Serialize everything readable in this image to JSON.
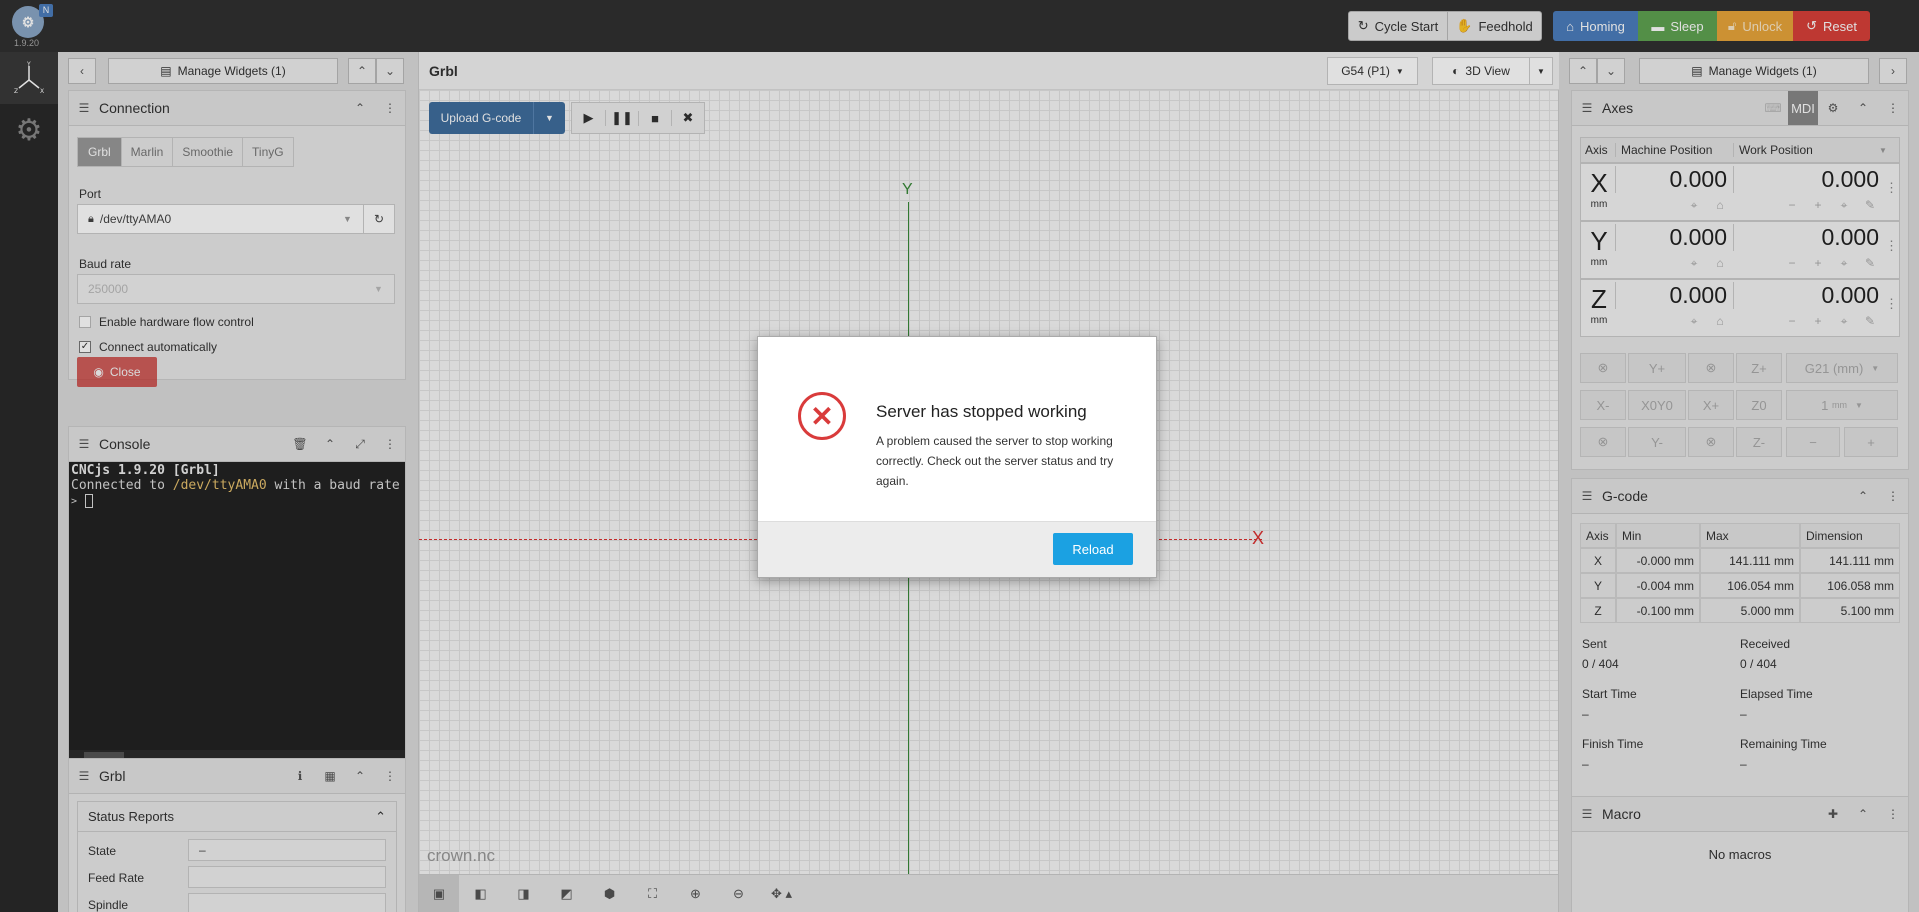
{
  "app": {
    "version": "1.9.20",
    "badge": "N"
  },
  "topbar": {
    "cycle_start": "Cycle Start",
    "feedhold": "Feedhold",
    "homing": "Homing",
    "sleep": "Sleep",
    "unlock": "Unlock",
    "reset": "Reset"
  },
  "colors": {
    "homing": "#4c7ebd",
    "sleep": "#5fa351",
    "unlock": "#e9a53b",
    "reset": "#d9403a",
    "reload": "#1ba1e2",
    "error": "#d93b3b"
  },
  "left": {
    "manage_widgets": "Manage Widgets (1)",
    "connection": {
      "title": "Connection",
      "tabs": [
        "Grbl",
        "Marlin",
        "Smoothie",
        "TinyG"
      ],
      "port_label": "Port",
      "port_value": "/dev/ttyAMA0",
      "baud_label": "Baud rate",
      "baud_value": "250000",
      "hw_flow": "Enable hardware flow control",
      "connect_auto": "Connect automatically",
      "close_button": "Close"
    },
    "console": {
      "title": "Console",
      "line1": "CNCjs 1.9.20 [Grbl]",
      "line2_prefix": "Connected to ",
      "line2_port": "/dev/ttyAMA0",
      "line2_suffix": " with a baud rate",
      "prompt": ">"
    },
    "grbl": {
      "title": "Grbl",
      "status_reports": "Status Reports",
      "state_label": "State",
      "state_value": "–",
      "feed_label": "Feed Rate",
      "spindle_label": "Spindle"
    }
  },
  "center": {
    "title": "Grbl",
    "coord_system": "G54 (P1)",
    "view": "3D View",
    "upload": "Upload G-code",
    "axis_y": "Y",
    "axis_x": "X",
    "filename": "crown.nc"
  },
  "right": {
    "manage_widgets": "Manage Widgets (1)",
    "axes": {
      "title": "Axes",
      "mdi": "MDI",
      "col_axis": "Axis",
      "col_machine": "Machine Position",
      "col_work": "Work Position",
      "rows": [
        {
          "axis": "X",
          "unit": "mm",
          "machine": "0.000",
          "work": "0.000"
        },
        {
          "axis": "Y",
          "unit": "mm",
          "machine": "0.000",
          "work": "0.000"
        },
        {
          "axis": "Z",
          "unit": "mm",
          "machine": "0.000",
          "work": "0.000"
        }
      ],
      "jog": {
        "yplus": "Y+",
        "zplus": "Z+",
        "units": "G21 (mm)",
        "xminus": "X-",
        "x0y0": "X0Y0",
        "xplus": "X+",
        "z0": "Z0",
        "step": "1",
        "step_unit": "mm",
        "yminus": "Y-",
        "zminus": "Z-",
        "minus": "−",
        "plus": "+"
      }
    },
    "gcode": {
      "title": "G-code",
      "headers": [
        "Axis",
        "Min",
        "Max",
        "Dimension"
      ],
      "rows": [
        [
          "X",
          "-0.000 mm",
          "141.111 mm",
          "141.111 mm"
        ],
        [
          "Y",
          "-0.004 mm",
          "106.054 mm",
          "106.058 mm"
        ],
        [
          "Z",
          "-0.100 mm",
          "5.000 mm",
          "5.100 mm"
        ]
      ],
      "sent_label": "Sent",
      "sent_value": "0 / 404",
      "received_label": "Received",
      "received_value": "0 / 404",
      "start_label": "Start Time",
      "start_value": "–",
      "elapsed_label": "Elapsed Time",
      "elapsed_value": "–",
      "finish_label": "Finish Time",
      "finish_value": "–",
      "remaining_label": "Remaining Time",
      "remaining_value": "–"
    },
    "macro": {
      "title": "Macro",
      "empty": "No macros"
    }
  },
  "modal": {
    "title": "Server has stopped working",
    "message": "A problem caused the server to stop working correctly. Check out the server status and try again.",
    "reload": "Reload"
  }
}
